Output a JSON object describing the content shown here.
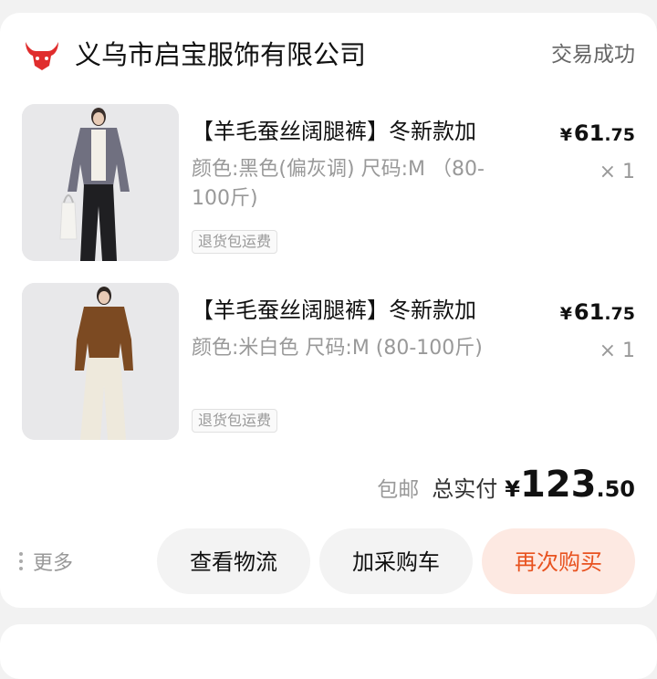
{
  "shop": {
    "name": "义乌市启宝服饰有限公司",
    "status": "交易成功",
    "icon": "bull-logo-icon",
    "brand_color": "#e02d2d"
  },
  "items": [
    {
      "title": "【羊毛蚕丝阔腿裤】冬新款加",
      "price_currency": "¥",
      "price_int": "61",
      "price_dec": ".75",
      "spec": "颜色:黑色(偏灰调) 尺码:M （80-100斤)",
      "qty": "× 1",
      "tag": "退货包运费",
      "image": "model-gray-cardigan-black-pants"
    },
    {
      "title": "【羊毛蚕丝阔腿裤】冬新款加",
      "price_currency": "¥",
      "price_int": "61",
      "price_dec": ".75",
      "spec": "颜色:米白色 尺码:M (80-100斤)",
      "qty": "× 1",
      "tag": "退货包运费",
      "image": "model-brown-sweater-white-pants"
    }
  ],
  "summary": {
    "shipping": "包邮",
    "total_label": "总实付",
    "currency": "¥",
    "total_int": "123",
    "total_dec": ".50"
  },
  "actions": {
    "more": "更多",
    "logistics": "查看物流",
    "add_cart": "加采购车",
    "rebuy": "再次购买",
    "accent_color": "#e8521f"
  }
}
